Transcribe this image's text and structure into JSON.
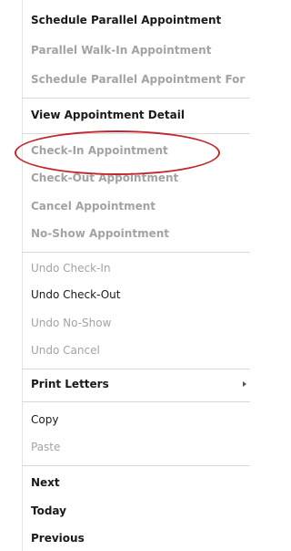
{
  "menu": {
    "items": [
      {
        "label": "Schedule Parallel Appointment",
        "enabled": true
      },
      {
        "label": "Parallel Walk-In Appointment",
        "enabled": false
      },
      {
        "label": "Schedule Parallel Appointment For",
        "enabled": false
      },
      {
        "label": "View Appointment Detail",
        "enabled": true
      },
      {
        "label": "Check-In Appointment",
        "enabled": false
      },
      {
        "label": "Check-Out Appointment",
        "enabled": false
      },
      {
        "label": "Cancel Appointment",
        "enabled": false
      },
      {
        "label": "No-Show Appointment",
        "enabled": false
      },
      {
        "label": "Undo Check-In",
        "enabled": false
      },
      {
        "label": "Undo Check-Out",
        "enabled": true
      },
      {
        "label": "Undo No-Show",
        "enabled": false
      },
      {
        "label": "Undo Cancel",
        "enabled": false
      },
      {
        "label": "Print Letters",
        "enabled": true,
        "has_submenu": true
      },
      {
        "label": "Copy",
        "enabled": true
      },
      {
        "label": "Paste",
        "enabled": false
      },
      {
        "label": "Next",
        "enabled": true
      },
      {
        "label": "Today",
        "enabled": true
      },
      {
        "label": "Previous",
        "enabled": true
      }
    ]
  },
  "annotation": {
    "highlight_color": "#c1272d",
    "highlighted_item": "View Appointment Detail"
  },
  "icons": {
    "submenu_arrow": "chevron-right-icon"
  }
}
